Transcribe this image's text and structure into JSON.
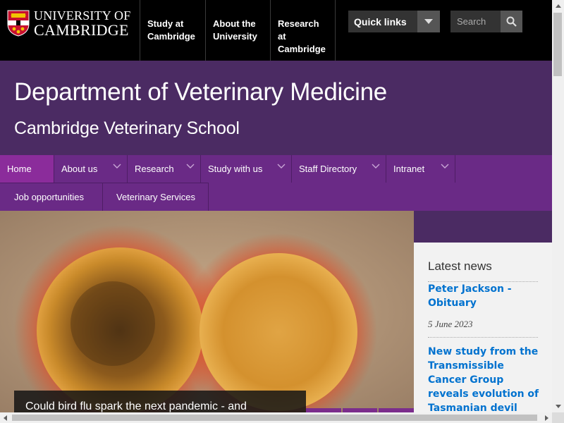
{
  "university": {
    "line1": "UNIVERSITY OF",
    "line2": "CAMBRIDGE"
  },
  "top_links": [
    {
      "label": "Study at\nCambridge"
    },
    {
      "label": "About the\nUniversity"
    },
    {
      "label": "Research at\nCambridge"
    }
  ],
  "quick_links": {
    "label": "Quick links",
    "icon": "chevron-down-icon"
  },
  "search": {
    "placeholder": "Search",
    "icon": "search-icon"
  },
  "header": {
    "title": "Department of Veterinary Medicine",
    "subtitle": "Cambridge Veterinary School"
  },
  "nav": {
    "row1": [
      {
        "label": "Home",
        "active": true
      },
      {
        "label": "About us",
        "has_menu": true
      },
      {
        "label": "Research",
        "has_menu": true
      },
      {
        "label": "Study with us",
        "has_menu": true
      },
      {
        "label": "Staff Directory",
        "has_menu": true
      },
      {
        "label": "Intranet",
        "has_menu": true
      }
    ],
    "row2": [
      {
        "label": "Job opportunities"
      },
      {
        "label": "Veterinary Services"
      }
    ]
  },
  "hero": {
    "caption": "Could bird flu spark the next pandemic - and"
  },
  "news": {
    "heading": "Latest news",
    "items": [
      {
        "title": "Peter Jackson - Obituary",
        "date": "5 June 2023"
      },
      {
        "title": "New study from the Transmissible Cancer Group reveals evolution of Tasmanian devil"
      }
    ]
  },
  "colors": {
    "black_bar": "#000000",
    "header_purple": "#4b2b63",
    "nav_purple": "#6a2a86",
    "nav_active": "#8b2c9b",
    "link_blue": "#0072cf"
  }
}
